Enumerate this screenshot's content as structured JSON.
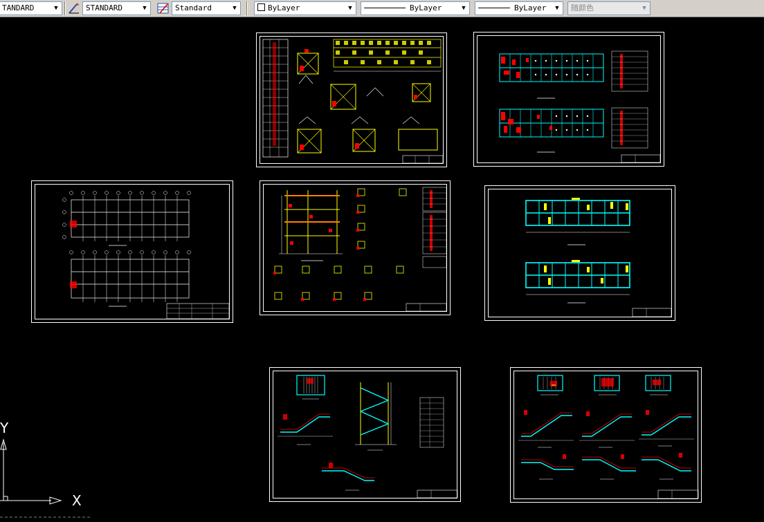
{
  "toolbar": {
    "text_style": "TANDARD",
    "dim_style": "STANDARD",
    "table_style": "Standard",
    "layer_color": "ByLayer",
    "linetype": "ByLayer",
    "lineweight": "ByLayer",
    "plot_style": "随颜色"
  },
  "canvas": {
    "background": "#000000",
    "ucs_x_label": "X",
    "ucs_y_label": "Y"
  },
  "colors": {
    "frame": "#ffffff",
    "yellow": "#ffff00",
    "cyan": "#00ffff",
    "red": "#ff0000",
    "magenta": "#ff00ff"
  },
  "sheets": [
    {
      "id": "foundation-details",
      "theme": "foundation"
    },
    {
      "id": "floor-plan-red-cyan",
      "theme": "plan-red"
    },
    {
      "id": "axis-grid-plan",
      "theme": "grid"
    },
    {
      "id": "frame-elevation-details",
      "theme": "frame"
    },
    {
      "id": "floor-plan-cyan-yellow",
      "theme": "plan-yellow"
    },
    {
      "id": "stair-details-a",
      "theme": "stair-a"
    },
    {
      "id": "stair-details-b",
      "theme": "stair-b"
    }
  ]
}
